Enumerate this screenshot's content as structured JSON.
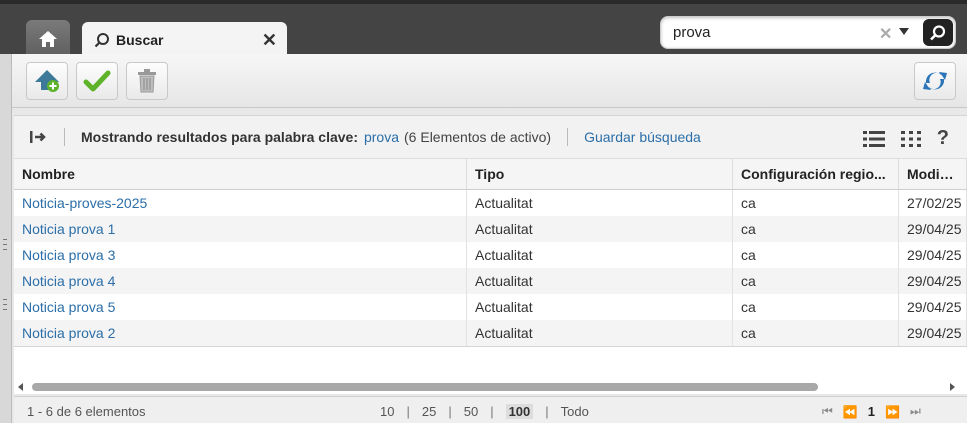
{
  "tabs": {
    "search_tab_label": "Buscar"
  },
  "global_search": {
    "value": "prova"
  },
  "results": {
    "label": "Mostrando resultados para palabra clave:",
    "keyword": "prova",
    "count_text": "(6 Elementos de activo)",
    "save_search": "Guardar búsqueda"
  },
  "table": {
    "columns": [
      "Nombre",
      "Tipo",
      "Configuración regio...",
      "Modifica"
    ],
    "rows": [
      {
        "name": "Noticia-proves-2025",
        "type": "Actualitat",
        "locale": "ca",
        "modified": "27/02/25"
      },
      {
        "name": "Noticia prova 1",
        "type": "Actualitat",
        "locale": "ca",
        "modified": "29/04/25"
      },
      {
        "name": "Noticia prova 3",
        "type": "Actualitat",
        "locale": "ca",
        "modified": "29/04/25"
      },
      {
        "name": "Noticia prova 4",
        "type": "Actualitat",
        "locale": "ca",
        "modified": "29/04/25"
      },
      {
        "name": "Noticia prova 5",
        "type": "Actualitat",
        "locale": "ca",
        "modified": "29/04/25"
      },
      {
        "name": "Noticia prova 2",
        "type": "Actualitat",
        "locale": "ca",
        "modified": "29/04/25"
      }
    ]
  },
  "pager": {
    "range": "1 - 6 de 6 elementos",
    "sizes": [
      "10",
      "25",
      "50",
      "100",
      "Todo"
    ],
    "active_size": "100",
    "current_page": "1"
  },
  "colors": {
    "link": "#2b6ea8",
    "topbar": "#444444",
    "accent_green": "#5fb32a"
  }
}
